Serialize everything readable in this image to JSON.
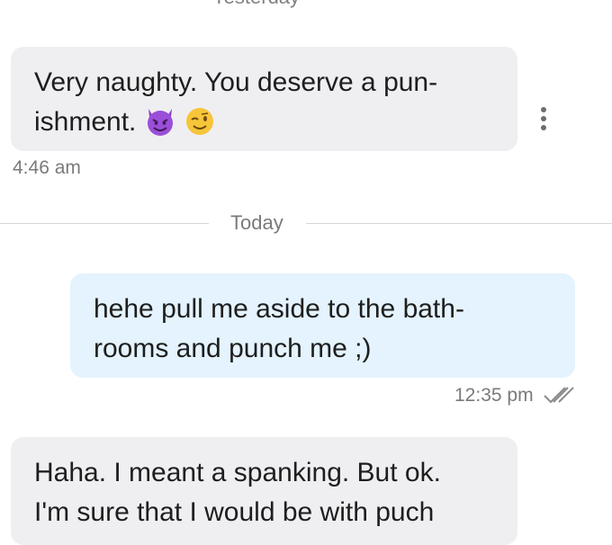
{
  "top_divider": {
    "label": "Yesterday"
  },
  "messages": [
    {
      "direction": "incoming",
      "lines": [
        "Very naughty. You deserve a pun-",
        "ishment."
      ],
      "emoji": [
        "smiling-devil-emoji",
        "winking-face-emoji"
      ],
      "time": "4:46 am"
    },
    {
      "direction": "outgoing",
      "lines": [
        "hehe pull me aside to the bath-",
        "rooms and punch me ;)"
      ],
      "time": "12:35 pm",
      "status": "read-double-check"
    },
    {
      "direction": "incoming",
      "lines": [
        "Haha. I meant a spanking. But ok.",
        "I'm sure that I would be with puch"
      ]
    }
  ],
  "day_divider": {
    "label": "Today"
  },
  "colors": {
    "incoming_bubble": "#efeff2",
    "outgoing_bubble": "#e4f3fd",
    "timestamp": "#7a7a7a",
    "divider": "#d6d6d6"
  },
  "icons": {
    "more_options": "vertical-ellipsis-icon",
    "read_receipt": "double-check-icon"
  }
}
